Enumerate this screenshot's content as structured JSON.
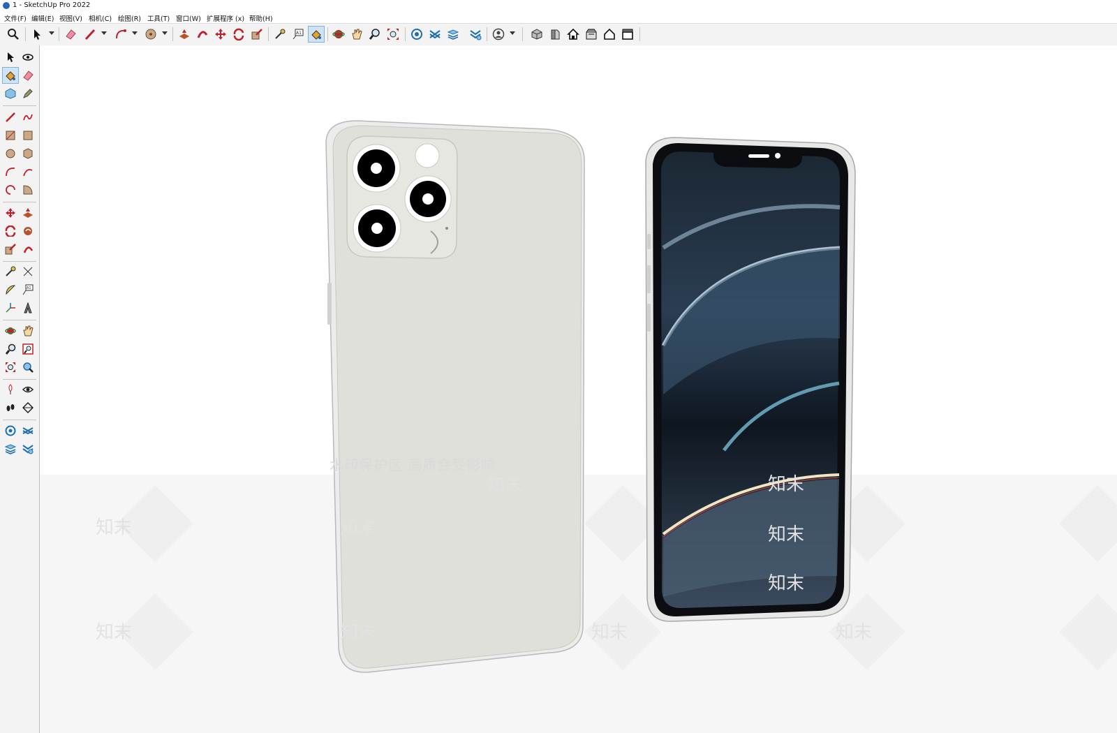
{
  "window": {
    "title": "1 - SketchUp Pro 2022"
  },
  "menu": {
    "items": [
      "文件(F)",
      "编辑(E)",
      "视图(V)",
      "相机(C)",
      "绘图(R)",
      "工具(T)",
      "窗口(W)",
      "扩展程序 (x)",
      "帮助(H)"
    ]
  },
  "toolbar": {
    "icons": [
      "search-icon",
      "select-icon",
      "eraser-icon",
      "pencil-icon",
      "arc-icon",
      "circle-icon",
      "push-pull-icon",
      "follow-me-icon",
      "move-icon",
      "rotate-icon",
      "scale-icon",
      "tape-measure-icon",
      "text-icon",
      "paint-bucket-icon",
      "orbit-icon",
      "pan-icon",
      "zoom-icon",
      "zoom-extents-icon",
      "warehouse-icon",
      "extension-manager-icon",
      "layers-icon",
      "styles-icon",
      "account-icon",
      "iso-view-icon",
      "front-view-icon",
      "home-icon",
      "back-view-icon",
      "house-icon",
      "side-view-icon"
    ],
    "active": "paint-bucket-icon"
  },
  "left_toolbar": {
    "icons": [
      "select-icon",
      "orbit-icon",
      "paint-bucket-icon",
      "eraser-icon",
      "component-icon",
      "tag-icon",
      "line-icon",
      "freehand-icon",
      "rectangle-icon",
      "rotated-rectangle-icon",
      "circle-icon",
      "polygon-icon",
      "arc-icon",
      "three-point-arc-icon",
      "pie-icon",
      "two-point-arc-icon",
      "move-icon",
      "push-pull-icon",
      "rotate-icon",
      "follow-me-icon",
      "scale-icon",
      "offset-icon",
      "tape-measure-icon",
      "dimension-icon",
      "protractor-icon",
      "text-icon",
      "axes-icon",
      "3d-text-icon",
      "orbit-icon",
      "pan-icon",
      "zoom-icon",
      "zoom-window-icon",
      "zoom-extents-icon",
      "previous-view-icon",
      "position-camera-icon",
      "look-around-icon",
      "walk-icon",
      "section-plane-icon",
      "warehouse-icon",
      "extension-warehouse-icon",
      "layers-icon",
      "styles-icon"
    ],
    "active": "paint-bucket-icon"
  },
  "watermark": {
    "line": "水印保护区  画质会受影响",
    "brand": "知末"
  },
  "colors": {
    "toolbar_bg": "#f3f3f3",
    "phone_back": "#dfe0d9",
    "phone_frame": "#e8e8e8",
    "screen_bezel": "#0b0d10",
    "accent_active": "#cfe3f5"
  }
}
